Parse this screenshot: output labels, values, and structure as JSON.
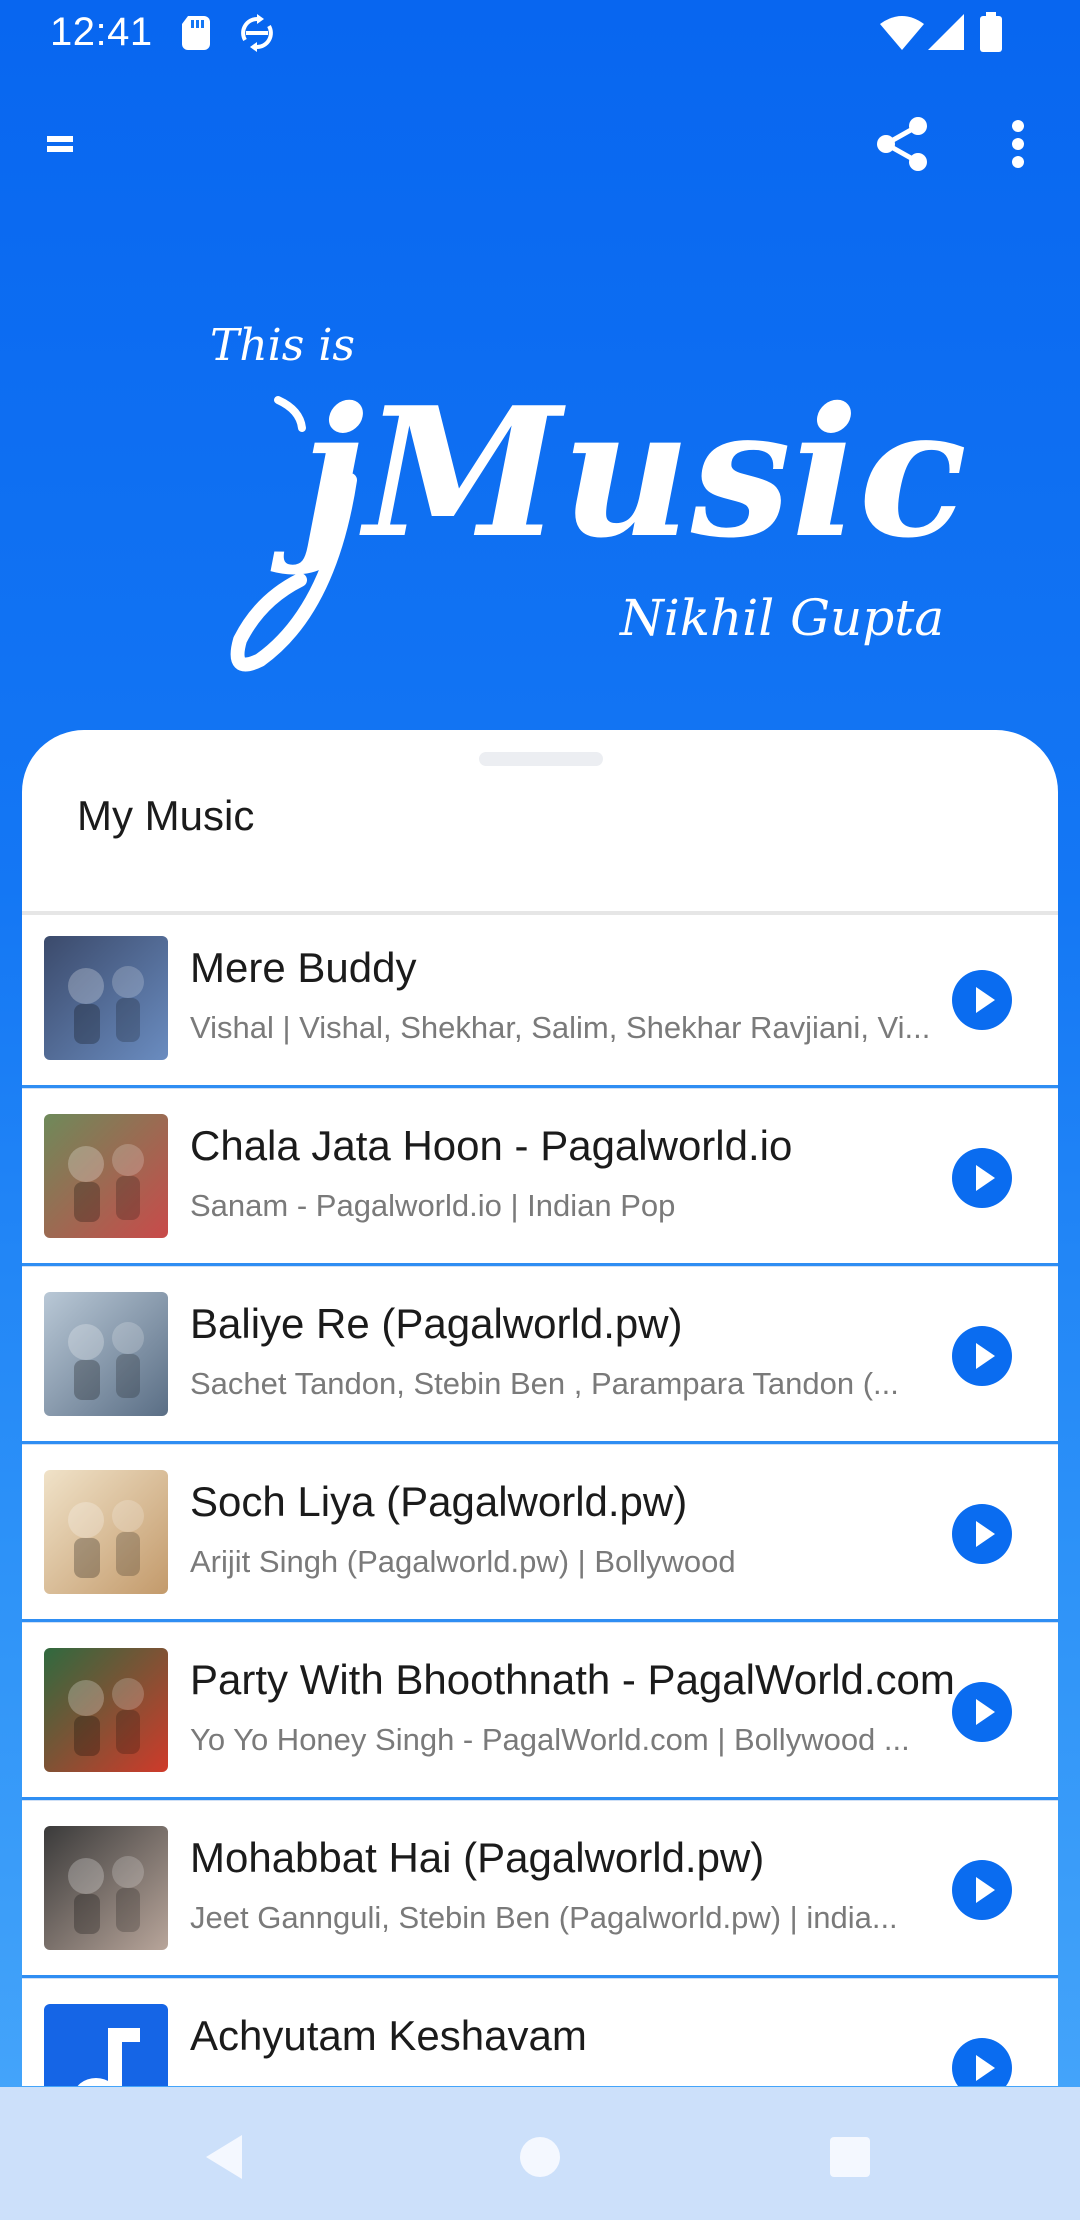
{
  "status_bar": {
    "time": "12:41",
    "icons": [
      "sd-card-icon",
      "sync-icon",
      "wifi-icon",
      "cellular-signal-icon",
      "battery-icon"
    ]
  },
  "toolbar": {
    "icons": [
      "menu-icon",
      "share-icon",
      "more-vert-icon"
    ]
  },
  "hero": {
    "tagline": "This is",
    "logo": "jMusic",
    "signature": "Nikhil Gupta"
  },
  "sheet": {
    "title": "My Music"
  },
  "songs": [
    {
      "title": "Mere Buddy",
      "subtitle": "Vishal | Vishal, Shekhar, Salim, Shekhar Ravjiani, Vi...",
      "art_colors": [
        "#3b4a6b",
        "#6a8cc0"
      ]
    },
    {
      "title": "Chala Jata Hoon - Pagalworld.io",
      "subtitle": "Sanam - Pagalworld.io | Indian Pop",
      "art_colors": [
        "#6e8a5a",
        "#c94a4a"
      ]
    },
    {
      "title": "Baliye Re (Pagalworld.pw)",
      "subtitle": "Sachet Tandon, Stebin Ben , Parampara Tandon (...",
      "art_colors": [
        "#b9c8d6",
        "#5a6e85"
      ]
    },
    {
      "title": "Soch Liya (Pagalworld.pw)",
      "subtitle": "Arijit Singh (Pagalworld.pw) | Bollywood",
      "art_colors": [
        "#f0e2c8",
        "#c39a6b"
      ]
    },
    {
      "title": "Party With Bhoothnath - PagalWorld.com",
      "subtitle": "Yo Yo Honey Singh - PagalWorld.com | Bollywood ...",
      "art_colors": [
        "#2f6a3f",
        "#d03a2a"
      ]
    },
    {
      "title": "Mohabbat Hai (Pagalworld.pw)",
      "subtitle": "Jeet Gannguli, Stebin Ben (Pagalworld.pw) | india...",
      "art_colors": [
        "#3a3a3a",
        "#b8a59a"
      ]
    },
    {
      "title": "Achyutam Keshavam",
      "subtitle": "",
      "art_colors": [
        "#1565e6",
        "#1565e6"
      ]
    }
  ],
  "nav_bar": {
    "icons": [
      "back-icon",
      "home-icon",
      "recents-icon"
    ]
  },
  "colors": {
    "accent": "#0a6cf0",
    "background_top": "#0866f0",
    "nav_bar": "#cce0fa"
  }
}
